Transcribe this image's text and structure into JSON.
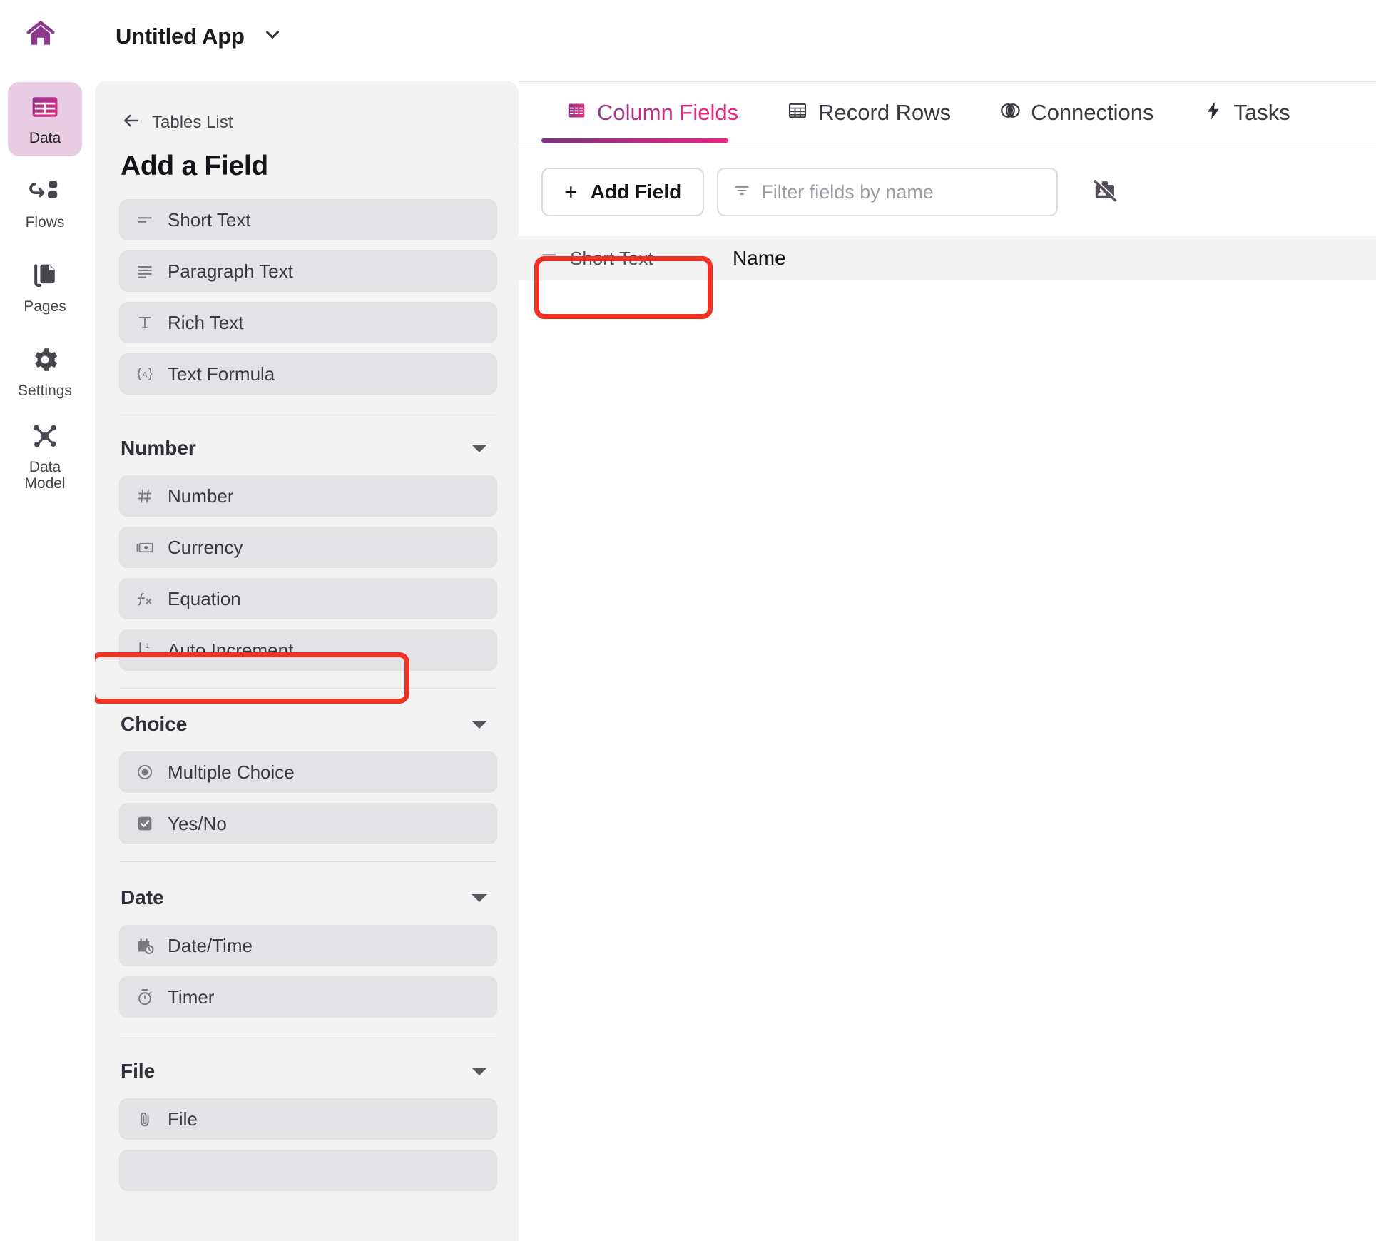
{
  "topbar": {
    "home_icon": "home-icon",
    "app_title": "Untitled App",
    "caret_icon": "chevron-down-icon"
  },
  "rail": {
    "items": [
      {
        "label": "Data",
        "icon": "table-icon",
        "active": true
      },
      {
        "label": "Flows",
        "icon": "flow-icon",
        "active": false
      },
      {
        "label": "Pages",
        "icon": "pages-icon",
        "active": false
      },
      {
        "label": "Settings",
        "icon": "gear-icon",
        "active": false
      },
      {
        "label": "Data Model",
        "icon": "data-model-icon",
        "active": false
      }
    ]
  },
  "panel": {
    "back_label": "Tables List",
    "back_icon": "arrow-left-icon",
    "title": "Add a Field",
    "groups": [
      {
        "name": "",
        "has_header": false,
        "items": [
          {
            "label": "Short Text",
            "icon": "short-text-icon"
          },
          {
            "label": "Paragraph Text",
            "icon": "paragraph-text-icon"
          },
          {
            "label": "Rich Text",
            "icon": "rich-text-icon"
          },
          {
            "label": "Text Formula",
            "icon": "text-formula-icon"
          }
        ]
      },
      {
        "name": "Number",
        "has_header": true,
        "items": [
          {
            "label": "Number",
            "icon": "hash-icon"
          },
          {
            "label": "Currency",
            "icon": "currency-icon"
          },
          {
            "label": "Equation",
            "icon": "equation-icon"
          },
          {
            "label": "Auto Increment",
            "icon": "auto-increment-icon",
            "highlighted": true
          }
        ]
      },
      {
        "name": "Choice",
        "has_header": true,
        "items": [
          {
            "label": "Multiple Choice",
            "icon": "radio-button-icon"
          },
          {
            "label": "Yes/No",
            "icon": "checkbox-icon"
          }
        ]
      },
      {
        "name": "Date",
        "has_header": true,
        "items": [
          {
            "label": "Date/Time",
            "icon": "calendar-clock-icon"
          },
          {
            "label": "Timer",
            "icon": "stopwatch-icon"
          }
        ]
      },
      {
        "name": "File",
        "has_header": true,
        "items": [
          {
            "label": "File",
            "icon": "paperclip-icon"
          }
        ]
      }
    ]
  },
  "main": {
    "tabs": [
      {
        "label": "Column Fields",
        "icon": "columns-icon",
        "active": true
      },
      {
        "label": "Record Rows",
        "icon": "grid-icon",
        "active": false
      },
      {
        "label": "Connections",
        "icon": "connections-icon",
        "active": false
      },
      {
        "label": "Tasks",
        "icon": "bolt-icon",
        "active": false
      }
    ],
    "toolbar": {
      "add_field_label": "Add Field",
      "add_field_plus": "+",
      "filter_placeholder": "Filter fields by name",
      "filter_value": "",
      "filter_icon": "filter-icon",
      "hide_fields_icon": "hide-fields-icon"
    },
    "field_rows": [
      {
        "type": "Short Text",
        "type_icon": "short-text-icon",
        "name": "Name"
      }
    ]
  },
  "colors": {
    "accent_purple": "#8d3a8e",
    "accent_pink": "#e8277f",
    "highlight_red": "#f03123",
    "panel_bg": "#f3f3f4",
    "item_bg": "#e3e2e5",
    "rail_active_bg": "#e8cce4"
  }
}
